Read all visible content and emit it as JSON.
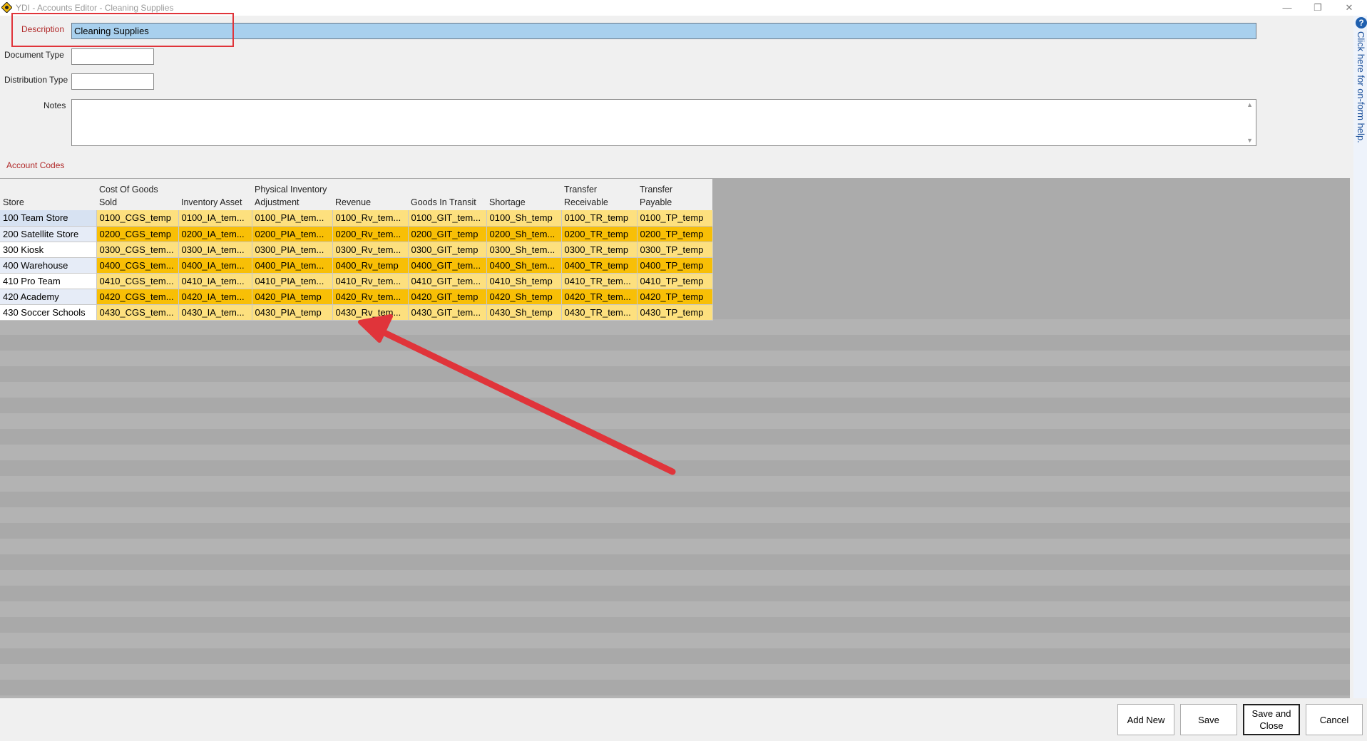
{
  "window": {
    "title": "YDI - Accounts Editor - Cleaning Supplies",
    "minimize_glyph": "—",
    "restore_glyph": "❐",
    "close_glyph": "✕"
  },
  "form": {
    "description_label": "Description",
    "description_value": "Cleaning Supplies",
    "document_type_label": "Document Type",
    "document_type_value": "",
    "distribution_type_label": "Distribution Type",
    "distribution_type_value": "",
    "notes_label": "Notes",
    "notes_value": "",
    "account_codes_label": "Account Codes"
  },
  "help": {
    "icon": "?",
    "text": "Click here for on-form help."
  },
  "grid": {
    "columns": [
      {
        "line1": "",
        "line2": "Store"
      },
      {
        "line1": "Cost Of Goods",
        "line2": "Sold"
      },
      {
        "line1": "",
        "line2": "Inventory Asset"
      },
      {
        "line1": "Physical Inventory",
        "line2": "Adjustment"
      },
      {
        "line1": "",
        "line2": "Revenue"
      },
      {
        "line1": "",
        "line2": "Goods In Transit"
      },
      {
        "line1": "",
        "line2": "Shortage"
      },
      {
        "line1": "Transfer",
        "line2": "Receivable"
      },
      {
        "line1": "Transfer",
        "line2": "Payable"
      }
    ],
    "rows": [
      {
        "store": "100 Team Store",
        "cgs": "0100_CGS_temp",
        "ia": "0100_IA_tem...",
        "pia": "0100_PIA_tem...",
        "rv": "0100_Rv_tem...",
        "git": "0100_GIT_tem...",
        "sh": "0100_Sh_temp",
        "tr": "0100_TR_temp",
        "tp": "0100_TP_temp"
      },
      {
        "store": "200 Satellite Store",
        "cgs": "0200_CGS_temp",
        "ia": "0200_IA_tem...",
        "pia": "0200_PIA_tem...",
        "rv": "0200_Rv_tem...",
        "git": "0200_GIT_temp",
        "sh": "0200_Sh_tem...",
        "tr": "0200_TR_temp",
        "tp": "0200_TP_temp"
      },
      {
        "store": "300 Kiosk",
        "cgs": "0300_CGS_tem...",
        "ia": "0300_IA_tem...",
        "pia": "0300_PIA_tem...",
        "rv": "0300_Rv_tem...",
        "git": "0300_GIT_temp",
        "sh": "0300_Sh_tem...",
        "tr": "0300_TR_temp",
        "tp": "0300_TP_temp"
      },
      {
        "store": "400 Warehouse",
        "cgs": "0400_CGS_tem...",
        "ia": "0400_IA_tem...",
        "pia": "0400_PIA_tem...",
        "rv": "0400_Rv_temp",
        "git": "0400_GIT_tem...",
        "sh": "0400_Sh_tem...",
        "tr": "0400_TR_temp",
        "tp": "0400_TP_temp"
      },
      {
        "store": "410 Pro Team",
        "cgs": "0410_CGS_tem...",
        "ia": "0410_IA_tem...",
        "pia": "0410_PIA_tem...",
        "rv": "0410_Rv_tem...",
        "git": "0410_GIT_tem...",
        "sh": "0410_Sh_temp",
        "tr": "0410_TR_tem...",
        "tp": "0410_TP_temp"
      },
      {
        "store": "420 Academy",
        "cgs": "0420_CGS_tem...",
        "ia": "0420_IA_tem...",
        "pia": "0420_PIA_temp",
        "rv": "0420_Rv_tem...",
        "git": "0420_GIT_temp",
        "sh": "0420_Sh_temp",
        "tr": "0420_TR_tem...",
        "tp": "0420_TP_temp"
      },
      {
        "store": "430 Soccer Schools",
        "cgs": "0430_CGS_tem...",
        "ia": "0430_IA_tem...",
        "pia": "0430_PIA_temp",
        "rv": "0430_Rv_tem...",
        "git": "0430_GIT_tem...",
        "sh": "0430_Sh_temp",
        "tr": "0430_TR_tem...",
        "tp": "0430_TP_temp"
      }
    ]
  },
  "buttons": {
    "add_new": "Add New",
    "save": "Save",
    "save_close_line1": "Save and",
    "save_close_line2": "Close",
    "cancel": "Cancel"
  },
  "colors": {
    "annotation_red": "#e0343a",
    "code_cell_light": "#fde07e",
    "code_cell_dark": "#f8bf06",
    "description_fill": "#a8d0ee"
  }
}
